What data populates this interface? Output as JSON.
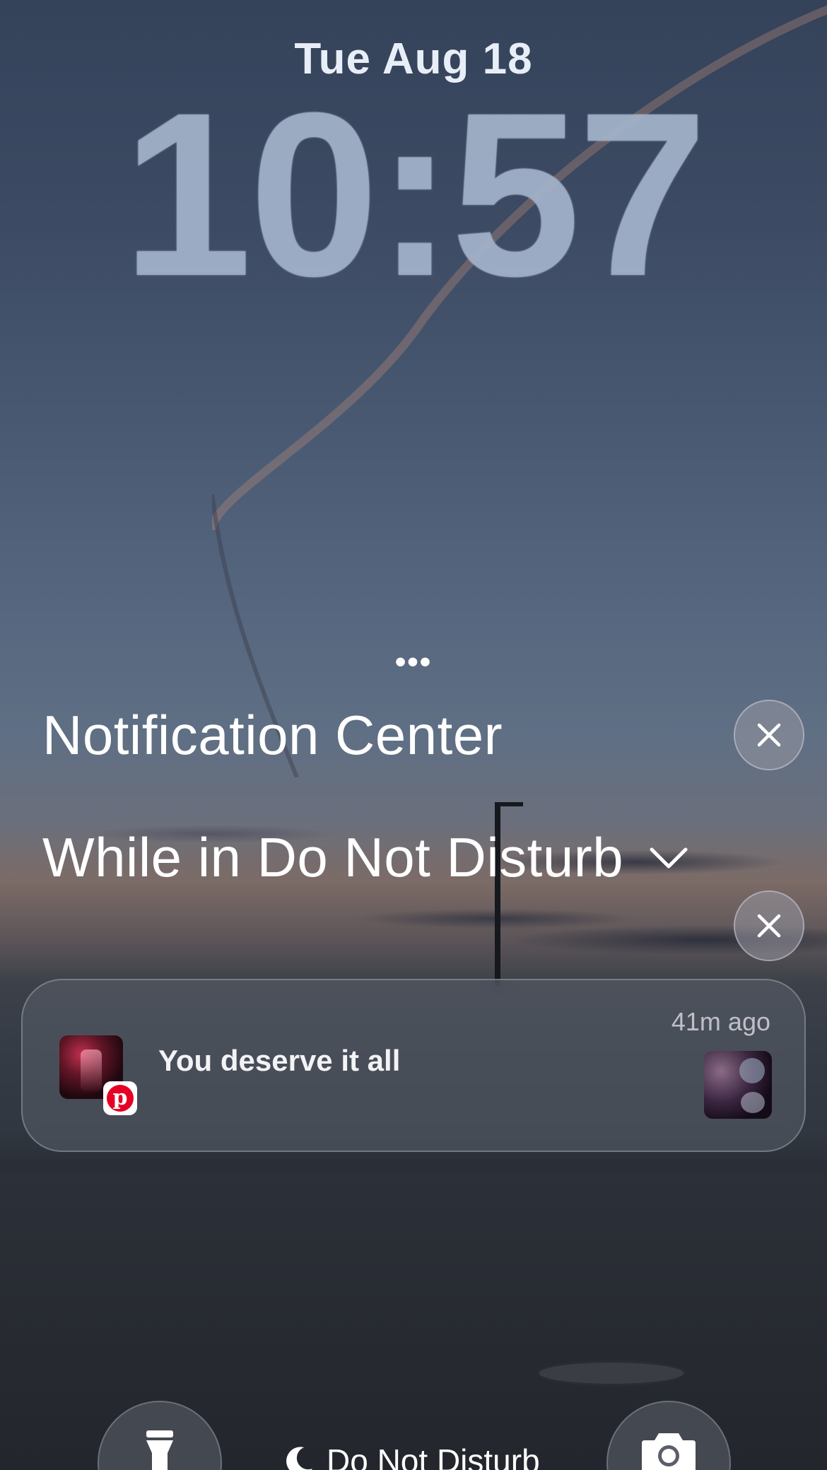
{
  "lock_screen": {
    "date": "Tue Aug 18",
    "time": "10:57"
  },
  "notification_center": {
    "more_indicator": "•••",
    "title": "Notification Center",
    "group_title": "While in Do Not Disturb"
  },
  "notification": {
    "message": "You deserve it all",
    "time_ago": "41m ago",
    "app_icon": "pinterest-icon"
  },
  "bottom_bar": {
    "focus_label": "Do Not Disturb",
    "left_icon": "flashlight-icon",
    "right_icon": "camera-icon"
  },
  "colors": {
    "pinterest_red": "#e60023",
    "text": "#ffffff"
  }
}
